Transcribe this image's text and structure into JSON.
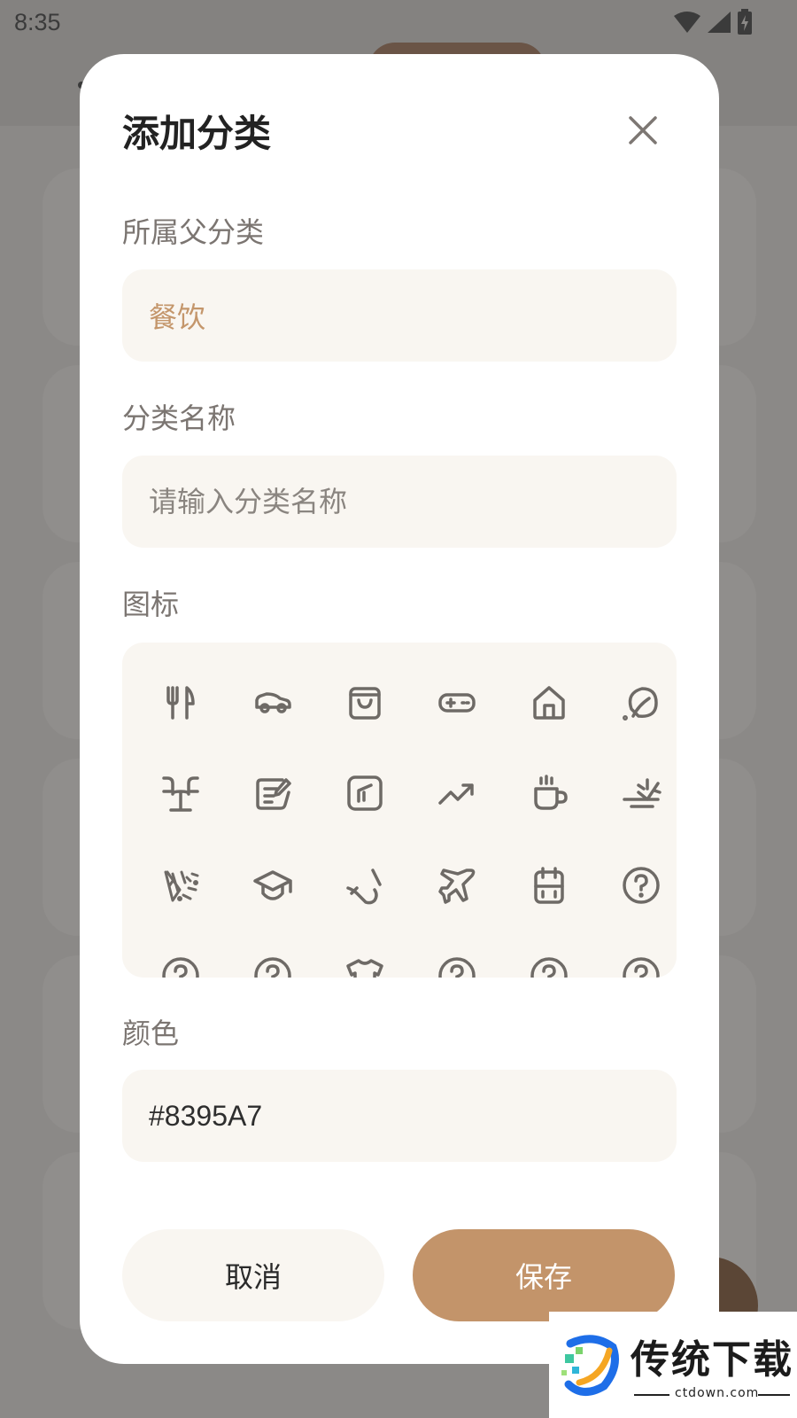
{
  "status_bar": {
    "time": "8:35"
  },
  "dialog": {
    "title": "添加分类",
    "parent_category": {
      "label": "所属父分类",
      "value": "餐饮"
    },
    "category_name": {
      "label": "分类名称",
      "placeholder": "请输入分类名称",
      "value": ""
    },
    "icon_section": {
      "label": "图标",
      "icons": [
        "fork-knife-icon",
        "car-icon",
        "shopping-bag-icon",
        "gamepad-icon",
        "home-icon",
        "leaf-icon",
        "text-cursor-icon",
        "note-edit-icon",
        "square-slash-icon",
        "trending-up-icon",
        "coffee-cup-icon",
        "weather-wind-icon",
        "confetti-icon",
        "graduation-cap-icon",
        "cord-icon",
        "airplane-icon",
        "battery-box-icon",
        "question-circle-icon",
        "question-circle-icon",
        "question-circle-icon",
        "tshirt-icon",
        "question-circle-icon",
        "question-circle-icon",
        "question-circle-icon"
      ]
    },
    "color_section": {
      "label": "颜色",
      "value": "#8395A7"
    },
    "buttons": {
      "cancel": "取消",
      "save": "保存"
    }
  },
  "watermark": {
    "title": "传统下载",
    "subtitle": "ctdown.com"
  },
  "colors": {
    "accent": "#C3946A",
    "field_bg": "#F9F6F1",
    "icon_stroke": "#6E6A66",
    "overlay": "#8B8987"
  }
}
